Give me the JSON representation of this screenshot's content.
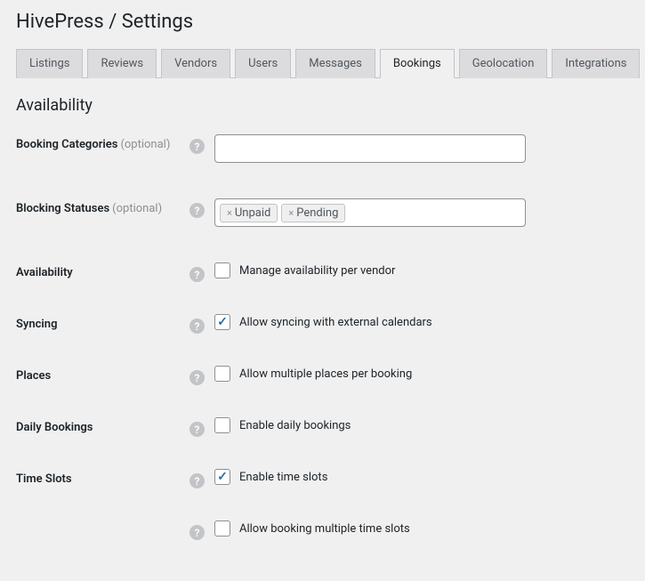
{
  "header": {
    "title": "HivePress / Settings"
  },
  "tabs": [
    {
      "label": "Listings",
      "active": false
    },
    {
      "label": "Reviews",
      "active": false
    },
    {
      "label": "Vendors",
      "active": false
    },
    {
      "label": "Users",
      "active": false
    },
    {
      "label": "Messages",
      "active": false
    },
    {
      "label": "Bookings",
      "active": true
    },
    {
      "label": "Geolocation",
      "active": false
    },
    {
      "label": "Integrations",
      "active": false
    }
  ],
  "section": {
    "title": "Availability"
  },
  "fields": {
    "booking_categories": {
      "label": "Booking Categories",
      "optional": "(optional)",
      "value": ""
    },
    "blocking_statuses": {
      "label": "Blocking Statuses",
      "optional": "(optional)",
      "tags": [
        "Unpaid",
        "Pending"
      ]
    },
    "availability": {
      "label": "Availability",
      "checkbox_label": "Manage availability per vendor",
      "checked": false
    },
    "syncing": {
      "label": "Syncing",
      "checkbox_label": "Allow syncing with external calendars",
      "checked": true
    },
    "places": {
      "label": "Places",
      "checkbox_label": "Allow multiple places per booking",
      "checked": false
    },
    "daily_bookings": {
      "label": "Daily Bookings",
      "checkbox_label": "Enable daily bookings",
      "checked": false
    },
    "time_slots": {
      "label": "Time Slots",
      "checkbox_label": "Enable time slots",
      "checked": true,
      "sub_checkbox_label": "Allow booking multiple time slots",
      "sub_checked": false
    }
  }
}
